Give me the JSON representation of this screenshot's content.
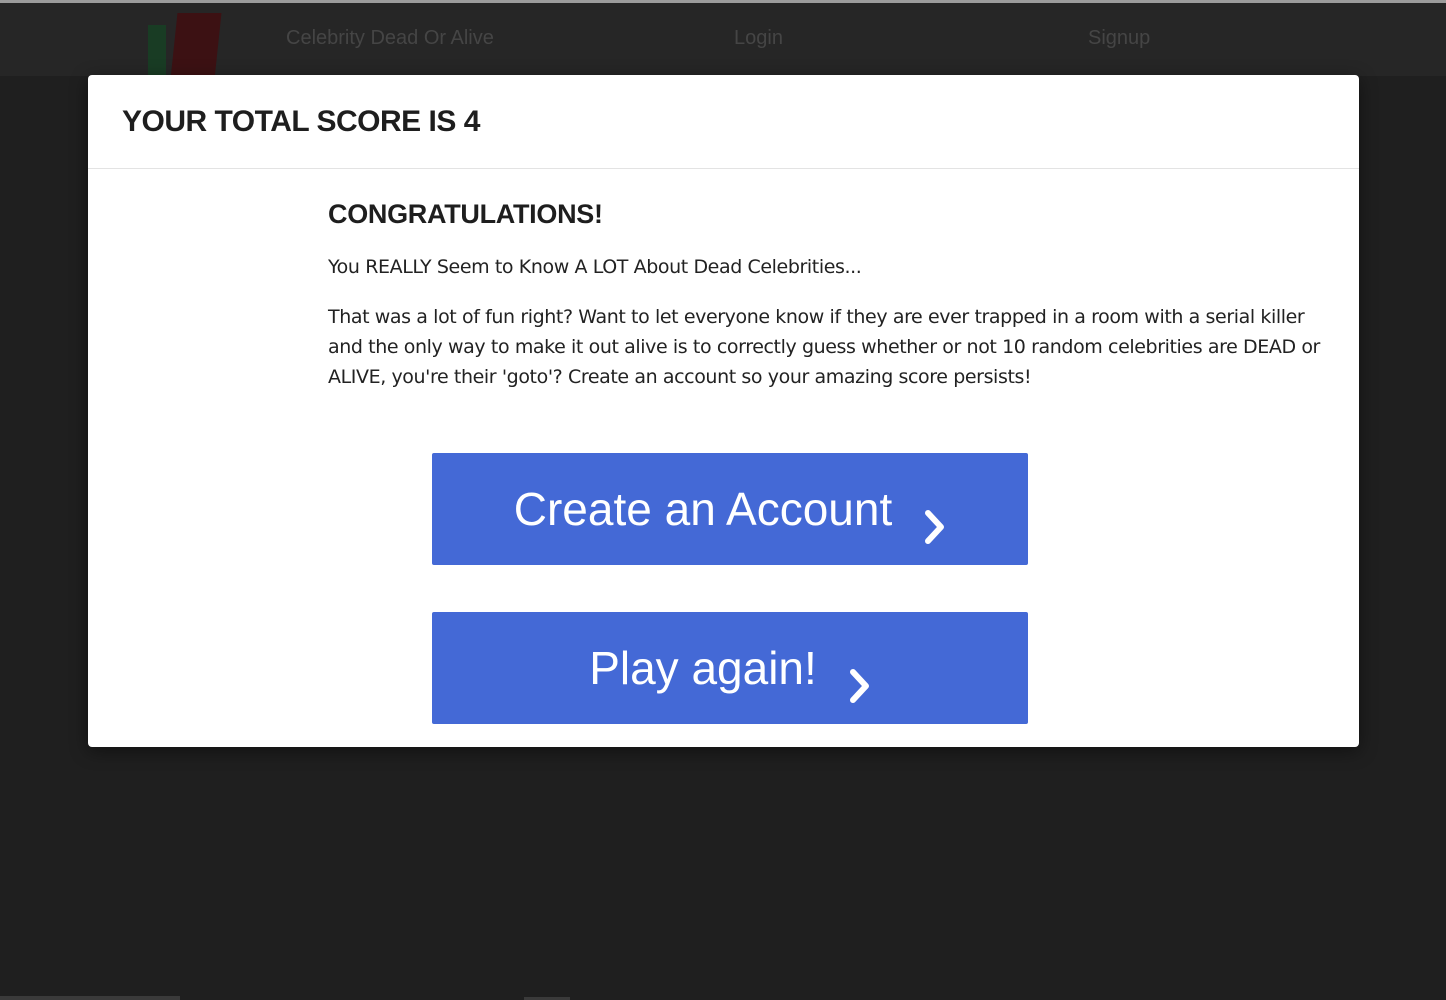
{
  "navbar": {
    "brand": "Celebrity Dead Or Alive",
    "login": "Login",
    "signup": "Signup"
  },
  "modal": {
    "title": "YOUR TOTAL SCORE IS 4",
    "heading": "CONGRATULATIONS!",
    "message": "You REALLY Seem to Know A LOT About Dead Celebrities...",
    "body": "That was a lot of fun right? Want to let everyone know if they are ever trapped in a room with a serial killer and the only way to make it out alive is to correctly guess whether or not 10 random celebrities are DEAD or ALIVE, you're their 'goto'? Create an account so your amazing score persists!",
    "create_account_label": "Create an Account",
    "play_again_label": "Play again!"
  },
  "icons": {
    "button_arrow": "chevron-right-icon"
  },
  "colors": {
    "button_bg": "#4469d6",
    "backdrop": "#262626",
    "modal_bg": "#ffffff"
  }
}
